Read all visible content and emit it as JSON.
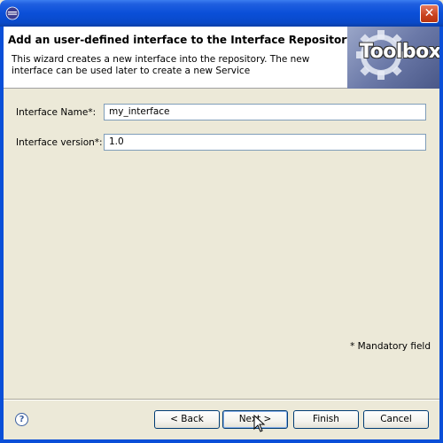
{
  "window": {
    "title": "",
    "close_glyph": "✕"
  },
  "banner": {
    "title": "Add an user-defined interface to the Interface Repository",
    "description": "This wizard creates a new interface into the repository. The new interface can be used later to create a new Service",
    "logo_text": "Toolbox"
  },
  "form": {
    "name_label": "Interface Name*:",
    "name_value": "my_interface",
    "version_label": "Interface version*:",
    "version_value": "1.0"
  },
  "mandatory_note": "* Mandatory field",
  "footer": {
    "help_glyph": "?",
    "back_label": "< Back",
    "next_label": "Next >",
    "finish_label": "Finish",
    "cancel_label": "Cancel"
  },
  "colors": {
    "titlebar": "#0a4fd8",
    "dialog_bg": "#ece9d8",
    "close_button": "#c8411d"
  }
}
